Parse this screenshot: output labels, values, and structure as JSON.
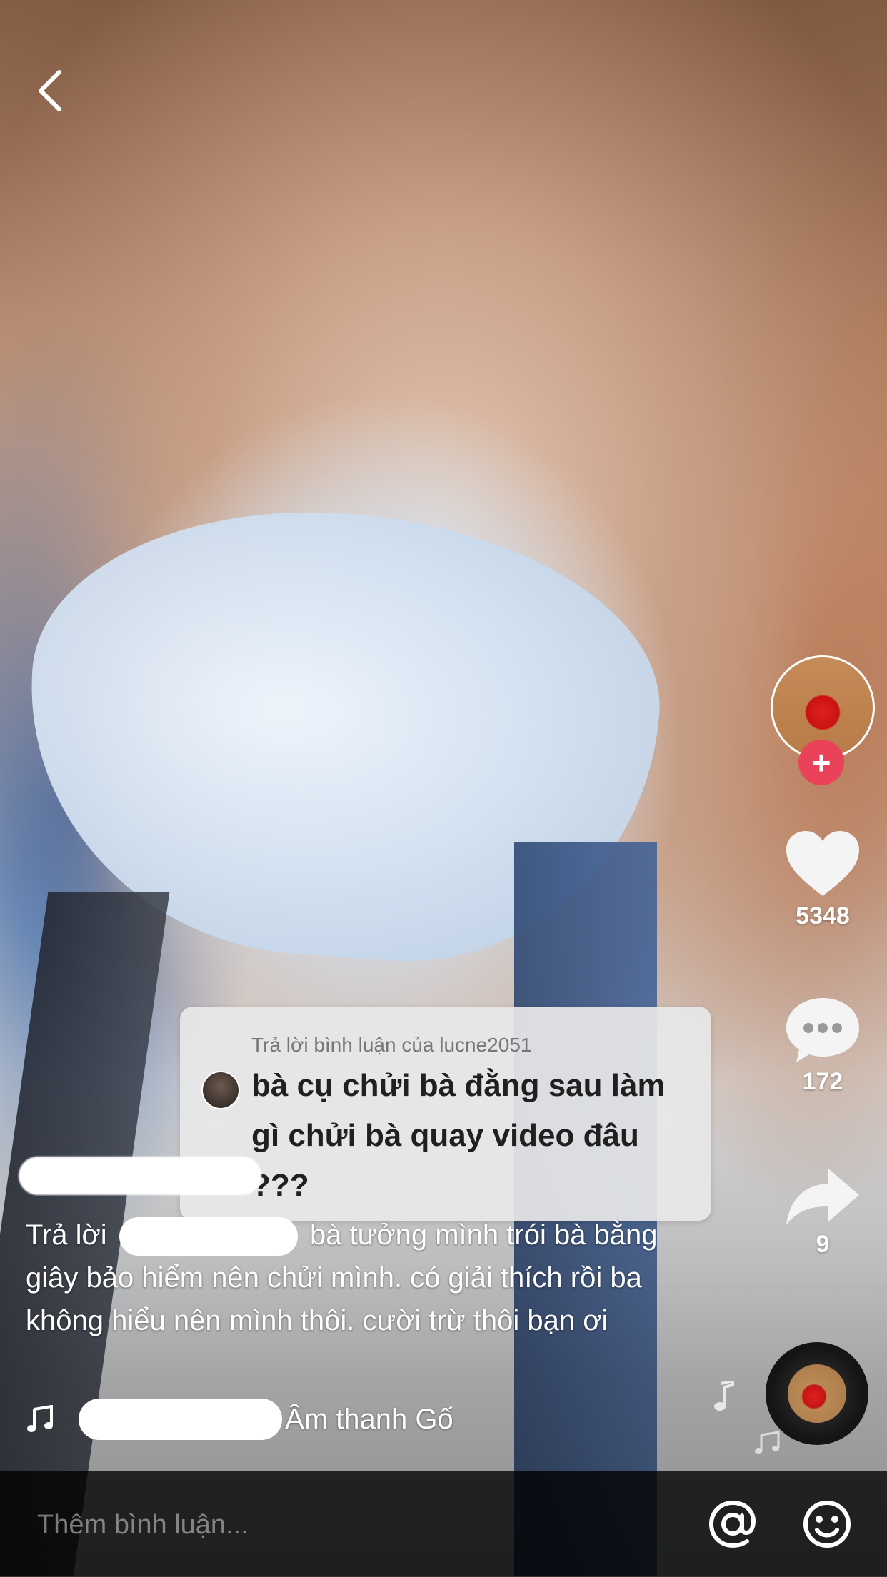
{
  "navigation": {
    "back_label": "Back"
  },
  "profile": {
    "follow_symbol": "+"
  },
  "actions": {
    "likes": "5348",
    "comments": "172",
    "shares": "9"
  },
  "reply_sticker": {
    "header": "Trả lời bình luận của lucne2051",
    "text": "bà cụ chửi bà đằng sau làm gì chửi bà quay video đâu ???"
  },
  "caption": {
    "prefix": "Trả lời",
    "text": "bà tưởng mình trói bà bằng giây bảo hiểm nên chửi mình. có giải thích rồi ba không hiểu nên mình thôi. cười trừ thôi bạn ơi"
  },
  "music": {
    "label": "Âm thanh Gố"
  },
  "comment_bar": {
    "placeholder": "Thêm bình luận..."
  },
  "colors": {
    "accent": "#ea4359",
    "overlay": "#000000"
  },
  "icons": [
    "back-icon",
    "heart-icon",
    "comment-icon",
    "share-icon",
    "music-note-icon",
    "at-icon",
    "emoji-icon"
  ]
}
